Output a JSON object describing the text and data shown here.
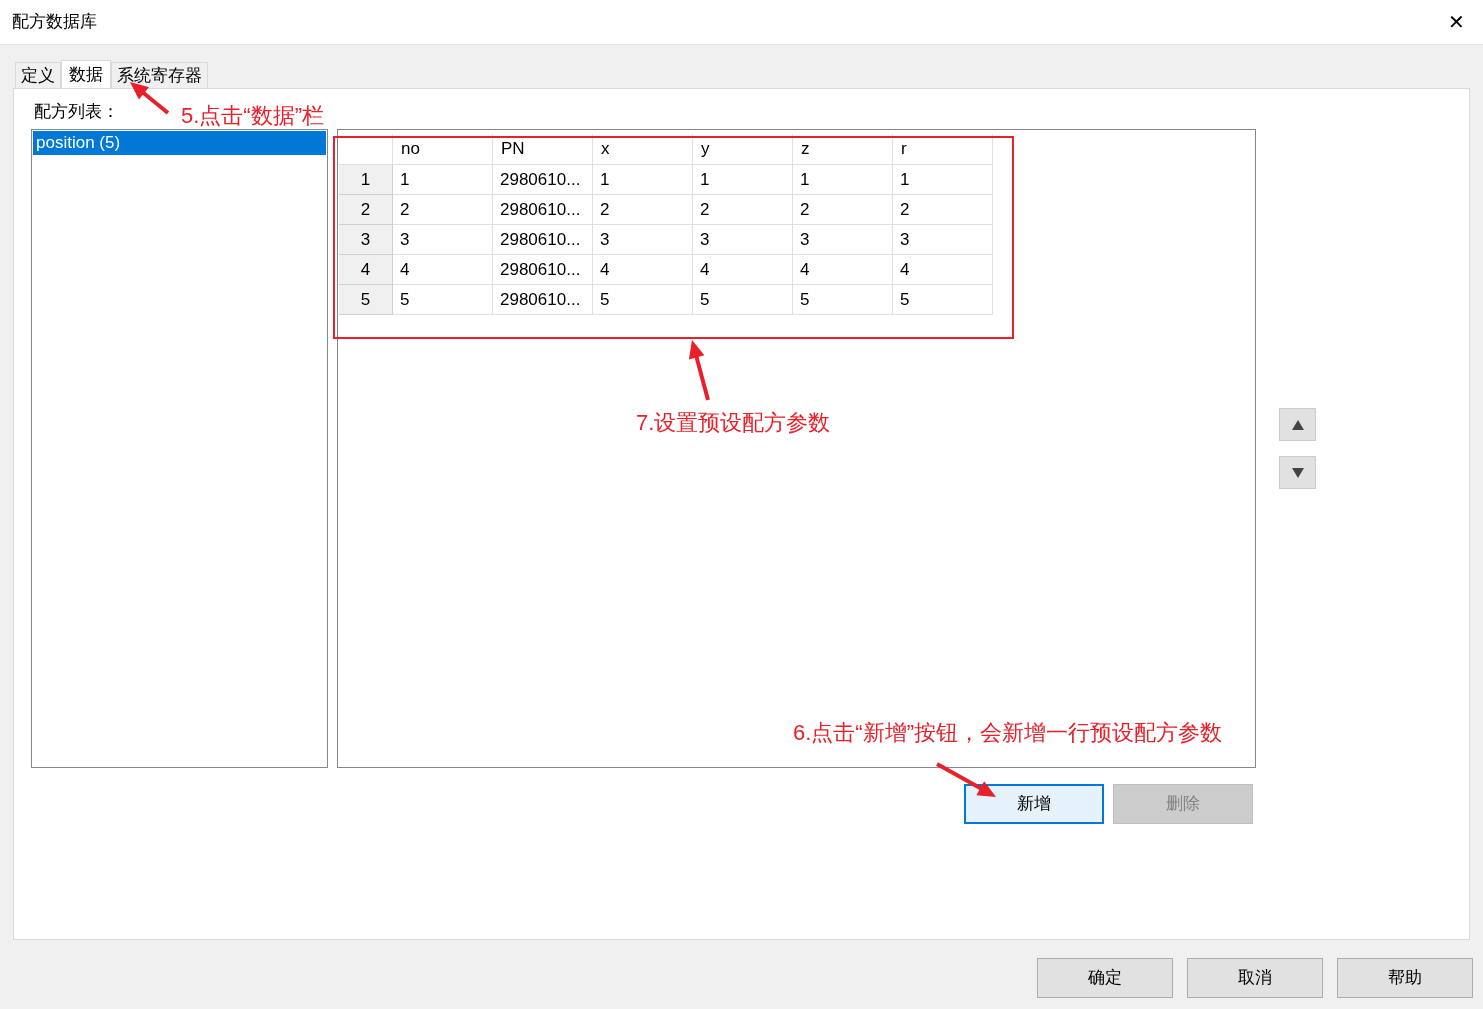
{
  "window": {
    "title": "配方数据库",
    "close": "✕"
  },
  "tabs": [
    {
      "label": "定义",
      "selected": false
    },
    {
      "label": "数据",
      "selected": true
    },
    {
      "label": "系统寄存器",
      "selected": false
    }
  ],
  "recipe_list": {
    "label": "配方列表：",
    "items": [
      {
        "label": "position (5)",
        "selected": true
      }
    ]
  },
  "table": {
    "columns": [
      "no",
      "PN",
      "x",
      "y",
      "z",
      "r"
    ],
    "rows": [
      {
        "header": "1",
        "cells": [
          "1",
          "2980610...",
          "1",
          "1",
          "1",
          "1"
        ]
      },
      {
        "header": "2",
        "cells": [
          "2",
          "2980610...",
          "2",
          "2",
          "2",
          "2"
        ]
      },
      {
        "header": "3",
        "cells": [
          "3",
          "2980610...",
          "3",
          "3",
          "3",
          "3"
        ]
      },
      {
        "header": "4",
        "cells": [
          "4",
          "2980610...",
          "4",
          "4",
          "4",
          "4"
        ]
      },
      {
        "header": "5",
        "cells": [
          "5",
          "2980610...",
          "5",
          "5",
          "5",
          "5"
        ]
      }
    ]
  },
  "buttons": [
    {
      "label": "新增",
      "disabled": false,
      "focused": true
    },
    {
      "label": "删除",
      "disabled": true,
      "focused": false
    }
  ],
  "dialog_buttons": [
    "确定",
    "取消",
    "帮助"
  ],
  "annotations": [
    {
      "text": "5.点击“数据”栏"
    },
    {
      "text": "7.设置预设配方参数"
    },
    {
      "text": "6.点击“新增”按钮，会新增一行预设配方参数"
    }
  ]
}
